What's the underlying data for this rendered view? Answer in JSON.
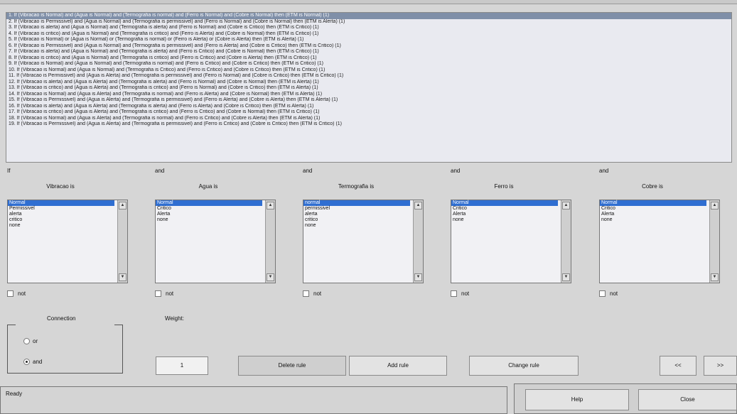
{
  "rules": [
    "1. If (Vibracao is Normal) and (Agua is Normal) and (Termografia is normal) and (Ferro is Normal) and (Cobre is Normal) then (ETM is Normal) (1)",
    "2. If (Vibracao is Permissivel) and (Agua is Normal) and (Termografia is permissivel) and (Ferro is Normal) and (Cobre is Normal) then (ETM is Alerta) (1)",
    "3. If (Vibracao is alerta) and (Agua is Normal) and (Termografia is alerta) and (Ferro is Normal) and (Cobre is Critico) then (ETM is Critico) (1)",
    "4. If (Vibracao is critico) and (Agua is Normal) and (Termografia is critico) and (Ferro is Alerta) and (Cobre is Normal) then (ETM is Critico) (1)",
    "5. If (Vibracao is Normal) or (Agua is Normal) or (Termografia is normal) or (Ferro is Alerta) or (Cobre is Alerta) then (ETM is Alerta) (1)",
    "6. If (Vibracao is Permissivel) and (Agua is Normal) and (Termografia is permissivel) and (Ferro is Alerta) and (Cobre is Critico) then (ETM is Critico) (1)",
    "7. If (Vibracao is alerta) and (Agua is Normal) and (Termografia is alerta) and (Ferro is Critico) and (Cobre is Normal) then (ETM is Critico) (1)",
    "8. If (Vibracao is critico) and (Agua is Normal) and (Termografia is critico) and (Ferro is Critico) and (Cobre is Alerta) then (ETM is Critico) (1)",
    "9. If (Vibracao is Normal) and (Agua is Normal) and (Termografia is normal) and (Ferro is Critico) and (Cobre is Critico) then (ETM is Critico) (1)",
    "10. If (Vibracao is Normal) and (Agua is Normal) and (Termografia is Critico) and (Ferro is Critico) and (Cobre is Critico) then (ETM is Critico) (1)",
    "11. If (Vibracao is Permissivel) and (Agua is Alerta) and (Termografia is permissivel) and (Ferro is Normal) and (Cobre is Critico) then (ETM is Critico) (1)",
    "12. If (Vibracao is alerta) and (Agua is Alerta) and (Termografia is alerta) and (Ferro is Normal) and (Cobre is Normal) then (ETM is Alerta) (1)",
    "13. If (Vibracao is critico) and (Agua is Alerta) and (Termografia is critico) and (Ferro is Normal) and (Cobre is Critico) then (ETM is Alerta) (1)",
    "14. If (Vibracao is Normal) and (Agua is Alerta) and (Termografia is normal) and (Ferro is Alerta) and (Cobre is Normal) then (ETM is Alerta) (1)",
    "15. If (Vibracao is Permissivel) and (Agua is Alerta) and (Termografia is permissivel) and (Ferro is Alerta) and (Cobre is Alerta) then (ETM is Alerta) (1)",
    "16. If (Vibracao is alerta) and (Agua is Alerta) and (Termografia is alerta) and (Ferro is Alerta) and (Cobre is Critico) then (ETM is Alerta) (1)",
    "17. If (Vibracao is critico) and (Agua is Alerta) and (Termografia is critico) and (Ferro is Critico) and (Cobre is Normal) then (ETM is Critico) (1)",
    "18. If (Vibracao is Normal) and (Agua is Alerta) and (Termografia is normal) and (Ferro is Critico) and (Cobre is Alerta) then (ETM is Alerta) (1)",
    "19. If (Vibracao is Permissivel) and (Agua is Alerta) and (Termografia is permissivel) and (Ferro is Critico) and (Cobre is Critico) then (ETM is Critico) (1)"
  ],
  "variables": [
    {
      "prefix": "If",
      "title": "Vibracao is",
      "options": [
        "Normal",
        "Permissivel",
        "alerta",
        "critico",
        "none"
      ],
      "selected": 0,
      "not_label": "not"
    },
    {
      "prefix": "and",
      "title": "Agua is",
      "options": [
        "Normal",
        "Critico",
        "Alerta",
        "none"
      ],
      "selected": 0,
      "not_label": "not"
    },
    {
      "prefix": "and",
      "title": "Termografia is",
      "options": [
        "normal",
        "permissivel",
        "alerta",
        "critico",
        "none"
      ],
      "selected": 0,
      "not_label": "not"
    },
    {
      "prefix": "and",
      "title": "Ferro is",
      "options": [
        "Normal",
        "Critico",
        "Alerta",
        "none"
      ],
      "selected": 0,
      "not_label": "not"
    },
    {
      "prefix": "and",
      "title": "Cobre is",
      "options": [
        "Normal",
        "Critico",
        "Alerta",
        "none"
      ],
      "selected": 0,
      "not_label": "not"
    }
  ],
  "connection": {
    "label": "Connection",
    "or_label": "or",
    "and_label": "and",
    "selected": "and"
  },
  "weight": {
    "label": "Weight:",
    "value": "1"
  },
  "buttons": {
    "delete": "Delete rule",
    "add": "Add rule",
    "change": "Change rule",
    "prev": "<<",
    "next": ">>",
    "help": "Help",
    "close": "Close"
  },
  "status": "Ready",
  "colors": {
    "selection": "#2f6ed1",
    "rule_highlight": "#7f8fa8",
    "panel": "#d6d6d6"
  }
}
